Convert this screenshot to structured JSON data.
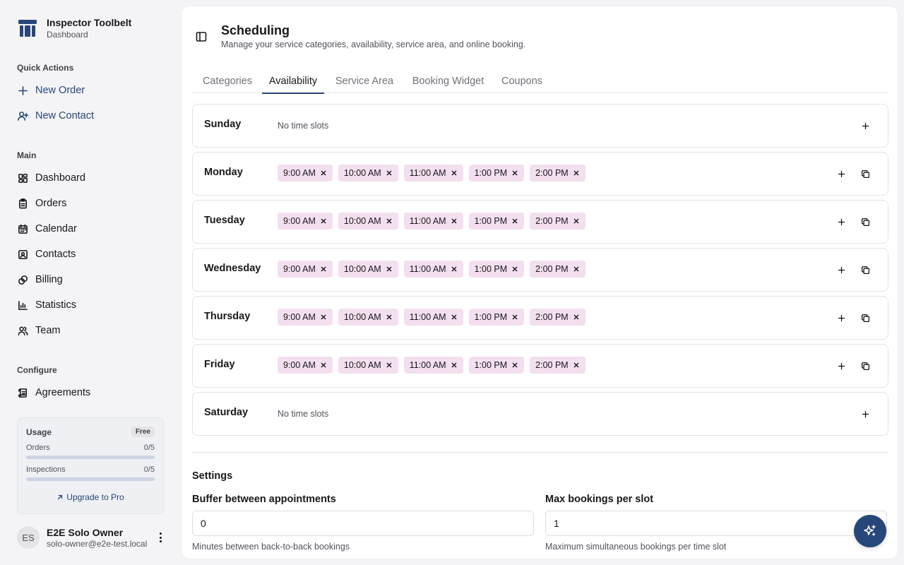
{
  "brand": {
    "name": "Inspector Toolbelt",
    "subtitle": "Dashboard",
    "color": "#27467a"
  },
  "quick_actions": {
    "label": "Quick Actions",
    "items": [
      {
        "label": "New Order",
        "icon": "plus-icon"
      },
      {
        "label": "New Contact",
        "icon": "user-plus-icon"
      }
    ]
  },
  "main_nav": {
    "label": "Main",
    "items": [
      {
        "label": "Dashboard",
        "icon": "dashboard-icon"
      },
      {
        "label": "Orders",
        "icon": "clipboard-icon"
      },
      {
        "label": "Calendar",
        "icon": "calendar-icon"
      },
      {
        "label": "Contacts",
        "icon": "contact-card-icon"
      },
      {
        "label": "Billing",
        "icon": "link-coins-icon"
      },
      {
        "label": "Statistics",
        "icon": "bar-chart-icon"
      },
      {
        "label": "Team",
        "icon": "users-icon"
      }
    ]
  },
  "configure": {
    "label": "Configure",
    "items": [
      {
        "label": "Agreements",
        "icon": "scroll-icon"
      }
    ]
  },
  "usage": {
    "title": "Usage",
    "plan": "Free",
    "orders": {
      "label": "Orders",
      "value": "0/5",
      "fraction": 0
    },
    "inspections": {
      "label": "Inspections",
      "value": "0/5",
      "fraction": 0
    },
    "upgrade_label": "Upgrade to Pro"
  },
  "user": {
    "initials": "ES",
    "name": "E2E Solo Owner",
    "email": "solo-owner@e2e-test.local"
  },
  "page": {
    "title": "Scheduling",
    "subtitle": "Manage your service categories, availability, service area, and online booking."
  },
  "tabs": [
    {
      "label": "Categories",
      "active": false
    },
    {
      "label": "Availability",
      "active": true
    },
    {
      "label": "Service Area",
      "active": false
    },
    {
      "label": "Booking Widget",
      "active": false
    },
    {
      "label": "Coupons",
      "active": false
    }
  ],
  "availability": {
    "empty_text": "No time slots",
    "days": [
      {
        "name": "Sunday",
        "slots": []
      },
      {
        "name": "Monday",
        "slots": [
          "9:00 AM",
          "10:00 AM",
          "11:00 AM",
          "1:00 PM",
          "2:00 PM"
        ]
      },
      {
        "name": "Tuesday",
        "slots": [
          "9:00 AM",
          "10:00 AM",
          "11:00 AM",
          "1:00 PM",
          "2:00 PM"
        ]
      },
      {
        "name": "Wednesday",
        "slots": [
          "9:00 AM",
          "10:00 AM",
          "11:00 AM",
          "1:00 PM",
          "2:00 PM"
        ]
      },
      {
        "name": "Thursday",
        "slots": [
          "9:00 AM",
          "10:00 AM",
          "11:00 AM",
          "1:00 PM",
          "2:00 PM"
        ]
      },
      {
        "name": "Friday",
        "slots": [
          "9:00 AM",
          "10:00 AM",
          "11:00 AM",
          "1:00 PM",
          "2:00 PM"
        ]
      },
      {
        "name": "Saturday",
        "slots": []
      }
    ]
  },
  "settings": {
    "title": "Settings",
    "buffer": {
      "label": "Buffer between appointments",
      "value": "0",
      "help": "Minutes between back-to-back bookings"
    },
    "max_bookings": {
      "label": "Max bookings per slot",
      "value": "1",
      "help": "Maximum simultaneous bookings per time slot"
    }
  },
  "colors": {
    "accent": "#27467a",
    "slot_chip": "#f3dff0",
    "page_bg": "#f4f4f6"
  }
}
